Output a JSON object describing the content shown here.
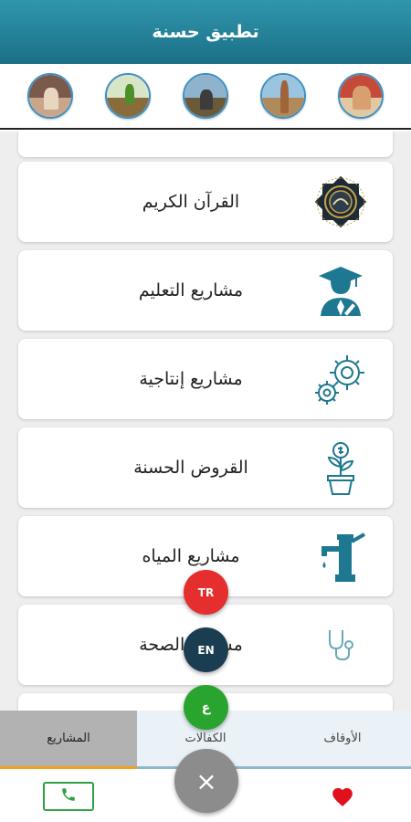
{
  "header": {
    "title": "تطبيق حسنة"
  },
  "stories": [
    {
      "name": "story-1",
      "sky": "#7a5a4a",
      "ground": "#c9a58a"
    },
    {
      "name": "story-2",
      "sky": "#d8e6c8",
      "ground": "#8a6b3c"
    },
    {
      "name": "story-3",
      "sky": "#8fb3cc",
      "ground": "#6a5a3a"
    },
    {
      "name": "story-4",
      "sky": "#9bc4e0",
      "ground": "#b08a5a"
    },
    {
      "name": "story-5",
      "sky": "#c44a3a",
      "ground": "#e0c8a0"
    }
  ],
  "cards": [
    {
      "label": "القرآن الكريم",
      "icon": "quran-icon"
    },
    {
      "label": "مشاريع التعليم",
      "icon": "graduate-icon"
    },
    {
      "label": "مشاريع إنتاجية",
      "icon": "gears-icon"
    },
    {
      "label": "القروض الحسنة",
      "icon": "money-plant-icon"
    },
    {
      "label": "مشاريع المياه",
      "icon": "water-pump-icon"
    },
    {
      "label": "مشاريع الصحة",
      "icon": "stethoscope-icon"
    }
  ],
  "tabs": {
    "projects": "المشاريع",
    "sponsorships": "الكفالات",
    "endowments": "الأوقاف"
  },
  "fab": {
    "tr": "TR",
    "en": "EN",
    "ar": "ع",
    "close": "×"
  },
  "colors": {
    "header": "#1c6f86",
    "accent": "#1e7891",
    "active_tab_underline": "#f0a21d",
    "fab_tr": "#e52e2e",
    "fab_en": "#1b3d52",
    "fab_ar": "#29a52f",
    "call": "#2ea043",
    "heart": "#e0101c"
  }
}
